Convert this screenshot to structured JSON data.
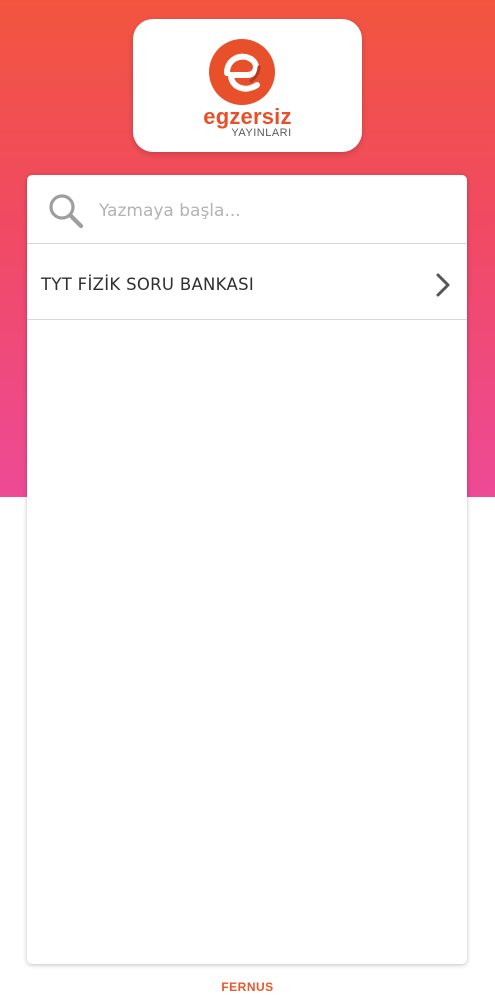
{
  "logo": {
    "brand": "egzersiz",
    "subtitle": "YAYINLARI",
    "icon": "egzersiz-logo-mark"
  },
  "search": {
    "placeholder": "Yazmaya başla...",
    "value": "",
    "icon": "search-icon"
  },
  "list": {
    "items": [
      {
        "label": "TYT FİZİK SORU BANKASI",
        "icon": "chevron-right-icon"
      }
    ]
  },
  "footer": {
    "brand": "FERNUS"
  },
  "colors": {
    "gradient_top": "#f2553f",
    "gradient_bottom": "#ee4a96",
    "brand_orange": "#e8502c",
    "footer_orange": "#e65a2c"
  }
}
